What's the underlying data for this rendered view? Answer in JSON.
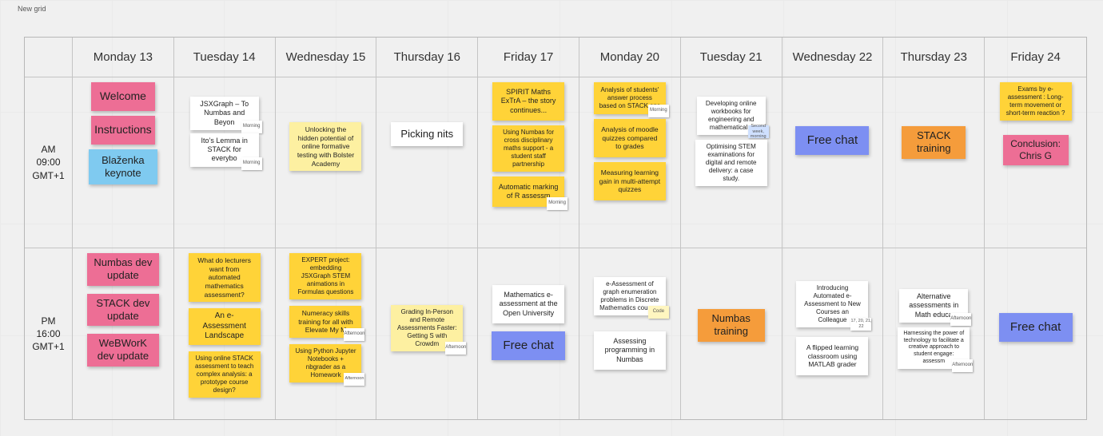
{
  "frame_title": "New grid",
  "row_labels": {
    "am": "AM\n09:00\nGMT+1",
    "pm": "PM\n16:00\nGMT+1"
  },
  "days": [
    "Monday 13",
    "Tuesday 14",
    "Wednesday 15",
    "Thursday 16",
    "Friday 17",
    "Monday 20",
    "Tuesday 21",
    "Wednesday 22",
    "Thursday 23",
    "Friday 24"
  ],
  "mini": {
    "morning": "Morning",
    "afternoon": "Afternoon",
    "second": "Second week, morning",
    "code": "Code",
    "slots17": "17, 20, 21, 22"
  },
  "am": {
    "mon13": {
      "welcome": "Welcome",
      "instructions": "Instructions",
      "keynote": "Blaženka keynote"
    },
    "tue14": {
      "a": "JSXGraph – To Numbas and Beyon",
      "b": "Ito’s Lemma in STACK for everybo"
    },
    "wed15": {
      "a": "Unlocking the hidden potential of online formative testing with Bolster Academy"
    },
    "thu16": {
      "a": "Picking nits"
    },
    "fri17": {
      "a": "SPIRIT Maths ExTrA – the story continues...",
      "b": "Using Numbas for cross disciplinary maths support - a student staff partnership",
      "c": "Automatic marking of R assessm"
    },
    "mon20": {
      "a": "Analysis of students' answer process based on STACK ans",
      "b": "Analysis of moodle quizzes compared to grades",
      "c": "Measuring learning gain in multi-attempt quizzes"
    },
    "tue21": {
      "a": "Developing online workbooks for engineering and mathematical s",
      "b": "Optimising STEM examinations for digital and remote delivery: a case study."
    },
    "wed22": {
      "a": "Free chat"
    },
    "thu23": {
      "a": "STACK training"
    },
    "fri24": {
      "a": "Exams by e-assessment : Long-term movement or short-term reaction ?",
      "b": "Conclusion: Chris G"
    }
  },
  "pm": {
    "mon13": {
      "a": "Numbas dev update",
      "b": "STACK dev update",
      "c": "WeBWorK dev update"
    },
    "tue14": {
      "a": "What do lecturers want from automated mathematics assessment?",
      "b": "An e-Assessment Landscape",
      "c": "Using online STACK assessment to teach complex analysis: a prototype course design?"
    },
    "wed15": {
      "a": "EXPERT project: embedding JSXGraph STEM animations in Formulas questions",
      "b": "Numeracy skills training for all with Elevate My M",
      "c": "Using Python Jupyter Notebooks + nbgrader as a Homework"
    },
    "thu16": {
      "a": "Grading In-Person and Remote Assessments Faster: Getting S with Crowdm"
    },
    "fri17": {
      "a": "Mathematics e-assessment at the Open University",
      "b": "Free chat"
    },
    "mon20": {
      "a": "e-Assessment of graph enumeration problems in Discrete Mathematics courses",
      "b": "Assessing programming in Numbas"
    },
    "tue21": {
      "a": "Numbas training"
    },
    "wed22": {
      "a": "Introducing Automated e-Assessment to New Courses an Colleague",
      "b": "A flipped learning classroom using MATLAB grader"
    },
    "thu23": {
      "a": "Alternative assessments in Math educa",
      "b": "Harnessing the power of technology to facilitate a creative approach to student engage: assessm"
    },
    "fri24": {
      "a": "Free chat"
    }
  }
}
